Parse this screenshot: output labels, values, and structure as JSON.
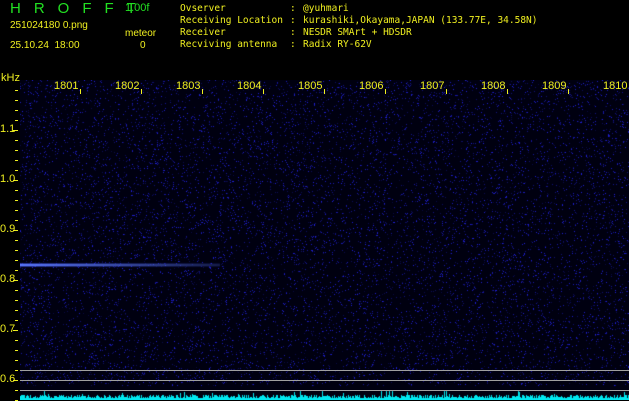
{
  "header": {
    "app_title": "HROFFT",
    "version": "1.00f",
    "filename": "251024180 0.png",
    "datetime": "25.10.24  18:00",
    "meteor_label": "meteor",
    "meteor_count": "0"
  },
  "info": [
    {
      "label": "Ovserver           ",
      "value": "@yuhmari"
    },
    {
      "label": "Receiving Location ",
      "value": "kurashiki,Okayama,JAPAN (133.77E, 34.58N)"
    },
    {
      "label": "Receiver           ",
      "value": "NESDR SMArt + HDSDR"
    },
    {
      "label": "Recviving antenna  ",
      "value": "Radix RY-62V"
    }
  ],
  "axis": {
    "y_unit": "kHz",
    "y_labels": [
      "1.1",
      "1.0",
      "0.9",
      "0.8",
      "0.7",
      "0.6"
    ],
    "x_labels": [
      "1801",
      "1802",
      "1803",
      "1804",
      "1805",
      "1806",
      "1807",
      "1808",
      "1809",
      "1810"
    ]
  },
  "colors": {
    "noise": "#2020c0",
    "meteor": "#6080ff",
    "spectrum": "#00e8f0",
    "text": "#f0f020",
    "title": "#22e022"
  },
  "detections": {
    "meteor_echo_freq_khz": 0.83,
    "meteor_echo_time": "1800-1803.6"
  }
}
